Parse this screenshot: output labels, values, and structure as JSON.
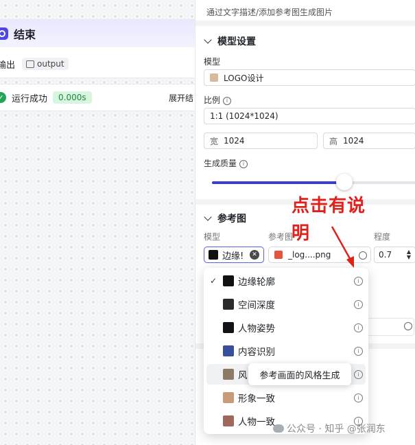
{
  "canvas": {
    "end_node": {
      "title": "结束",
      "output_label": "输出",
      "output_tag": "output"
    },
    "run": {
      "status": "运行成功",
      "time": "0.000s",
      "expand_label": "展开结"
    }
  },
  "panel": {
    "hint": "通过文字描述/添加参考图生成图片",
    "model_section": {
      "title": "模型设置",
      "model_label": "模型",
      "model_value": "LOGO设计",
      "ratio_label": "比例",
      "ratio_value": "1:1 (1024*1024)",
      "width_prefix": "宽",
      "width_value": "1024",
      "height_prefix": "高",
      "height_value": "1024",
      "quality_label": "生成质量",
      "quality_level": 0.65
    },
    "reference_section": {
      "title": "参考图",
      "col_model": "模型",
      "col_ref": "参考图",
      "col_degree": "程度",
      "selected_model": "边缘!",
      "file_name": "_log....png",
      "degree_value": "0.7"
    }
  },
  "annotation": {
    "line1": "点击有说",
    "line2": "明"
  },
  "dropdown": {
    "options": [
      {
        "label": "边缘轮廓",
        "checked": true,
        "thumb_color": "#111111"
      },
      {
        "label": "空间深度",
        "checked": false,
        "thumb_color": "#2b2b2b"
      },
      {
        "label": "人物姿势",
        "checked": false,
        "thumb_color": "#101418"
      },
      {
        "label": "内容识别",
        "checked": false,
        "thumb_color": "#3a4f9c"
      },
      {
        "label": "风",
        "checked": false,
        "thumb_color": "#8c7a66"
      },
      {
        "label": "形象一致",
        "checked": false,
        "thumb_color": "#c89b7a"
      },
      {
        "label": "人物一致",
        "checked": false,
        "thumb_color": "#a0685c"
      }
    ],
    "tooltip": "参考画面的风格生成"
  },
  "watermark": {
    "text": "公众号 · 知乎 @张润东"
  }
}
